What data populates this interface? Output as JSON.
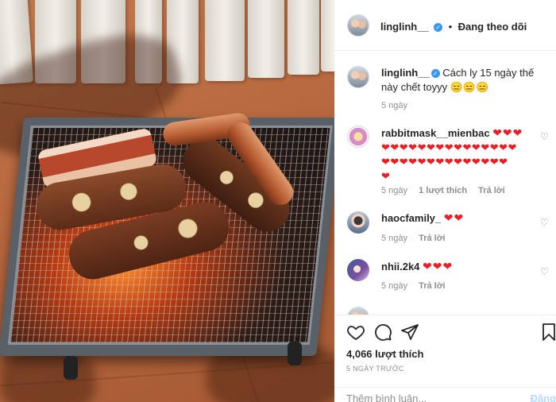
{
  "photo": {
    "alt_icon": "bbq-grill-photo"
  },
  "header": {
    "username": "linglinh__",
    "verified_icon": "verified-badge-icon",
    "separator": "•",
    "follow_label": "Đang theo dõi"
  },
  "caption": {
    "username": "linglinh__",
    "text": "Cách ly 15 ngày thế này chết toyyy 😑😑😑",
    "time": "5 ngày"
  },
  "comments": [
    {
      "username": "rabbitmask__mienbac",
      "text": "❤️❤️❤️ ❤️❤️❤️❤️❤️❤️❤️❤️❤️❤️❤️❤️ ❤️❤️❤️❤️❤️❤️❤️❤️❤️❤️❤️❤️❤️ ❤️",
      "hearts_line1": "❤❤❤",
      "hearts_line2": "❤❤❤❤❤❤❤❤❤❤❤❤❤❤❤",
      "hearts_line3": "❤❤❤❤❤❤❤❤❤❤❤❤❤❤",
      "hearts_line4": "❤",
      "time": "5 ngày",
      "likes": "1 lượt thích",
      "reply": "Trả lời"
    },
    {
      "username": "haocfamily_",
      "hearts": "❤❤",
      "time": "5 ngày",
      "reply": "Trả lời"
    },
    {
      "username": "nhii.2k4",
      "hearts": "❤❤❤",
      "time": "5 ngày",
      "reply": "Trả lời"
    }
  ],
  "actions": {
    "like_icon": "heart-outline-icon",
    "comment_icon": "comment-icon",
    "share_icon": "share-icon",
    "save_icon": "bookmark-icon",
    "likes_count": "4,066 lượt thích",
    "date": "5 NGÀY TRƯỚC"
  },
  "add_comment": {
    "placeholder": "Thêm bình luận...",
    "post_label": "Đăng"
  },
  "colors": {
    "verified": "#3897f0",
    "heart": "#ed1c24",
    "muted": "#8e8e8e",
    "post_disabled": "#b3dbff"
  }
}
